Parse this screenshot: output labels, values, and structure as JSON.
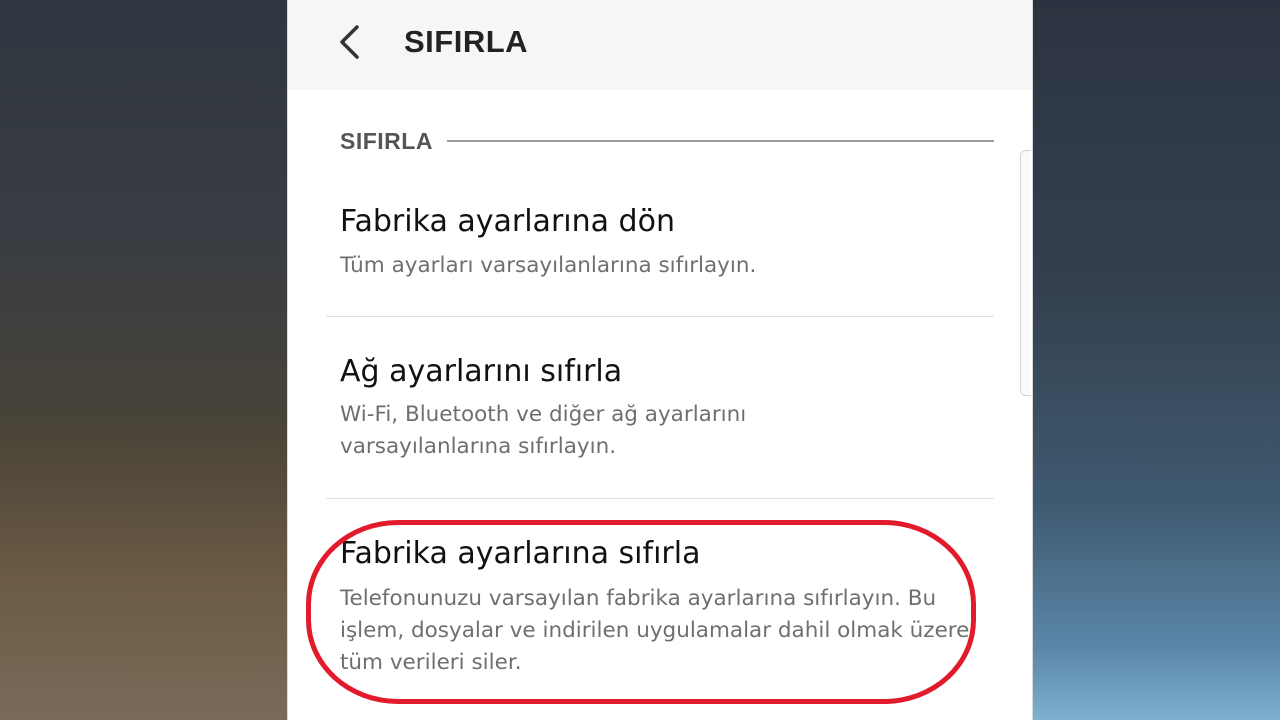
{
  "app_bar": {
    "title": "SIFIRLA",
    "back_icon": "chevron-left-icon"
  },
  "section": {
    "label": "SIFIRLA"
  },
  "items": [
    {
      "title": "Fabrika ayarlarına dön",
      "description": "Tüm ayarları varsayılanlarına sıfırlayın."
    },
    {
      "title": "Ağ ayarlarını sıfırla",
      "description": "Wi-Fi, Bluetooth ve diğer ağ ayarlarını varsayılanlarına sıfırlayın."
    },
    {
      "title": "Fabrika ayarlarına sıfırla",
      "description": "Telefonunuzu varsayılan fabrika ayarlarına sıfırlayın. Bu işlem, dosyalar ve indirilen uygulamalar dahil olmak üzere tüm verileri siler."
    }
  ],
  "colors": {
    "highlight": "#e21b2c",
    "title_text": "#111111",
    "description_text": "#6f6f6f"
  }
}
